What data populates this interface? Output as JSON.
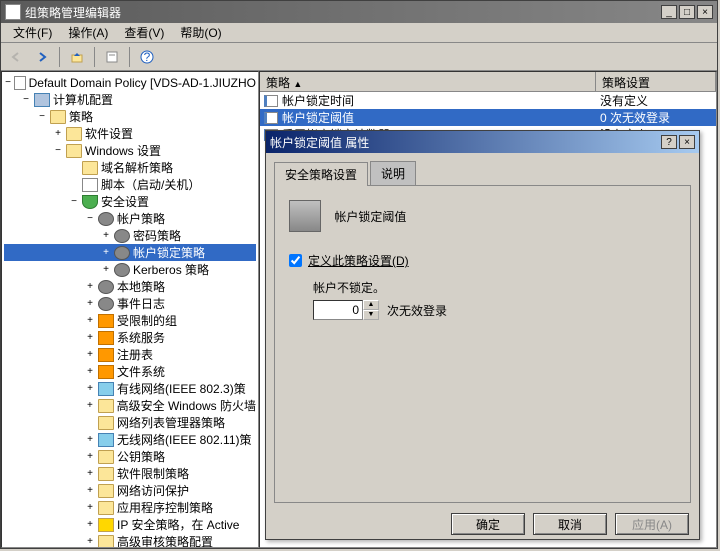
{
  "window": {
    "title": "组策略管理编辑器"
  },
  "menubar": {
    "file": "文件(F)",
    "action": "操作(A)",
    "view": "查看(V)",
    "help": "帮助(O)"
  },
  "tree": {
    "root": "Default Domain Policy [VDS-AD-1.JIUZHO",
    "computer_config": "计算机配置",
    "policies": "策略",
    "software_settings": "软件设置",
    "windows_settings": "Windows 设置",
    "domain_name_policy": "域名解析策略",
    "scripts": "脚本（启动/关机）",
    "security_settings": "安全设置",
    "account_policies": "帐户策略",
    "password_policy": "密码策略",
    "account_lockout_policy": "帐户锁定策略",
    "kerberos_policy": "Kerberos 策略",
    "local_policies": "本地策略",
    "event_log": "事件日志",
    "restricted_groups": "受限制的组",
    "system_services": "系统服务",
    "registry": "注册表",
    "file_system": "文件系统",
    "wired_network": "有线网络(IEEE 802.3)策",
    "windows_firewall": "高级安全 Windows 防火墙",
    "network_list": "网络列表管理器策略",
    "wireless_network": "无线网络(IEEE 802.11)策",
    "public_key": "公钥策略",
    "software_restriction": "软件限制策略",
    "app_protection": "网络访问保护",
    "app_control": "应用程序控制策略",
    "ip_security": "IP 安全策略，在 Active",
    "advanced_audit": "高级审核策略配置"
  },
  "list": {
    "header_policy": "策略",
    "header_setting": "策略设置",
    "rows": [
      {
        "name": "帐户锁定时间",
        "value": "没有定义"
      },
      {
        "name": "帐户锁定阈值",
        "value": "0 次无效登录"
      },
      {
        "name": "重置帐户锁定计数器",
        "value": "没有定义"
      }
    ]
  },
  "dialog": {
    "title": "帐户锁定阈值 属性",
    "tab_security": "安全策略设置",
    "tab_explain": "说明",
    "policy_name": "帐户锁定阈值",
    "define_checkbox": "定义此策略设置(D)",
    "field_label": "帐户不锁定。",
    "spinner_value": "0",
    "spinner_suffix": "次无效登录",
    "btn_ok": "确定",
    "btn_cancel": "取消",
    "btn_apply": "应用(A)"
  }
}
